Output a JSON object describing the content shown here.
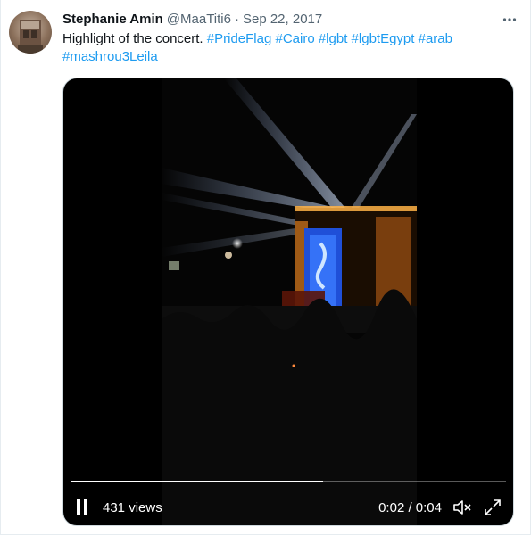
{
  "tweet": {
    "author_name": "Stephanie Amin",
    "handle": "@MaaTiti6",
    "separator": "·",
    "date": "Sep 22, 2017",
    "text_plain": "Highlight of the concert.",
    "hashtags": [
      "#PrideFlag",
      "#Cairo",
      "#lgbt",
      "#lgbtEgypt",
      "#arab",
      "#mashrou3Leila"
    ],
    "more_icon": "more-horizontal-icon"
  },
  "video": {
    "views": "431 views",
    "time": "0:02 / 0:04",
    "progress": 0.58,
    "pause_icon": "pause-icon",
    "mute_icon": "speaker-muted-icon",
    "fullscreen_icon": "expand-icon"
  },
  "colors": {
    "text": "#0f1419",
    "secondary": "#536471",
    "link": "#1d9bf0"
  }
}
